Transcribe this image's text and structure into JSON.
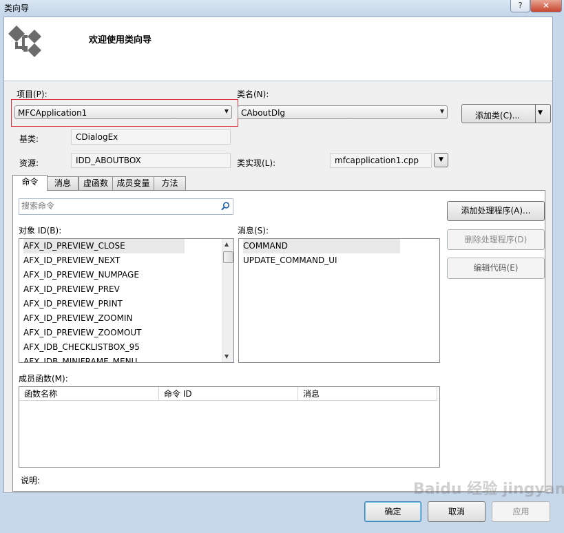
{
  "window": {
    "title": "类向导",
    "help_label": "?",
    "close_label": "✕"
  },
  "header": {
    "welcome": "欢迎使用类向导"
  },
  "project": {
    "label": "项目(P):",
    "value": "MFCApplication1"
  },
  "class_name": {
    "label": "类名(N):",
    "value": "CAboutDlg",
    "add_class_label": "添加类(C)..."
  },
  "base_class": {
    "label": "基类:",
    "value": "CDialogEx"
  },
  "resource": {
    "label": "资源:",
    "value": "IDD_ABOUTBOX"
  },
  "class_impl": {
    "label": "类实现(L):",
    "value": "mfcapplication1.cpp"
  },
  "tabs": [
    {
      "label": "命令",
      "active": true
    },
    {
      "label": "消息",
      "active": false
    },
    {
      "label": "虚函数",
      "active": false
    },
    {
      "label": "成员变量",
      "active": false
    },
    {
      "label": "方法",
      "active": false
    }
  ],
  "search": {
    "placeholder": "搜索命令"
  },
  "object_ids": {
    "label": "对象 ID(B):",
    "items": [
      "AFX_ID_PREVIEW_CLOSE",
      "AFX_ID_PREVIEW_NEXT",
      "AFX_ID_PREVIEW_NUMPAGE",
      "AFX_ID_PREVIEW_PREV",
      "AFX_ID_PREVIEW_PRINT",
      "AFX_ID_PREVIEW_ZOOMIN",
      "AFX_ID_PREVIEW_ZOOMOUT",
      "AFX_IDB_CHECKLISTBOX_95",
      "AFX_IDB_MINIFRAME_MENU"
    ]
  },
  "messages": {
    "label": "消息(S):",
    "items": [
      "COMMAND",
      "UPDATE_COMMAND_UI"
    ]
  },
  "actions": {
    "add_handler": "添加处理程序(A)...",
    "delete_handler": "删除处理程序(D)",
    "edit_code": "编辑代码(E)"
  },
  "member_functions": {
    "label": "成员函数(M):",
    "columns": [
      "函数名称",
      "命令 ID",
      "消息"
    ]
  },
  "description": {
    "label": "说明:"
  },
  "footer": {
    "ok": "确定",
    "cancel": "取消",
    "apply": "应用"
  },
  "watermark": "Baidu 经验  jingyan.baidu.com"
}
